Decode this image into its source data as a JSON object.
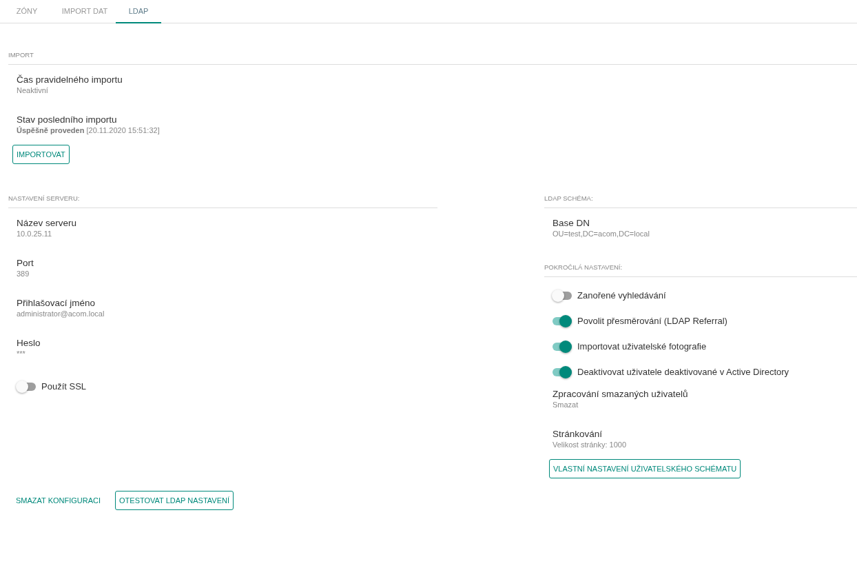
{
  "tabs": [
    {
      "label": "ZÓNY",
      "selected": false
    },
    {
      "label": "IMPORT DAT",
      "selected": false
    },
    {
      "label": "LDAP",
      "selected": true
    }
  ],
  "import": {
    "heading": "IMPORT",
    "items": [
      {
        "kind": "field",
        "label": "Čas pravidelného importu",
        "value": "Neaktivní"
      },
      {
        "kind": "field",
        "label": "Stav posledního importu",
        "value": "**Úspěšně proveden** [20.11.2020 15:51:32]"
      }
    ],
    "button": "IMPORTOVAT"
  },
  "server": {
    "heading": "NASTAVENÍ SERVERU:",
    "items": [
      {
        "kind": "field",
        "label": "Název serveru",
        "value": "10.0.25.11"
      },
      {
        "kind": "field",
        "label": "Port",
        "value": "389"
      },
      {
        "kind": "field",
        "label": "Přihlašovací jméno",
        "value": "administrator@acom.local"
      },
      {
        "kind": "field",
        "label": "Heslo",
        "value": "***"
      },
      {
        "kind": "toggle",
        "label": "Použít SSL",
        "on": false
      }
    ]
  },
  "schema": {
    "heading": "LDAP SCHÉMA:",
    "items": [
      {
        "kind": "field",
        "label": "Base DN",
        "value": "OU=test,DC=acom,DC=local"
      }
    ]
  },
  "advanced": {
    "heading": "POKROČILÁ NASTAVENÍ:",
    "items": [
      {
        "kind": "toggle",
        "label": "Zanořené vyhledávání",
        "on": false
      },
      {
        "kind": "toggle",
        "label": "Povolit přesměrování (LDAP Referral)",
        "on": true
      },
      {
        "kind": "toggle",
        "label": "Importovat uživatelské fotografie",
        "on": true
      },
      {
        "kind": "toggle",
        "label": "Deaktivovat uživatele deaktivované v Active Directory",
        "on": true
      },
      {
        "kind": "field",
        "label": "Zpracování smazaných uživatelů",
        "value": "Smazat"
      },
      {
        "kind": "field",
        "label": "Stránkování",
        "value": "Velikost stránky: 1000"
      }
    ],
    "button": "VLASTNÍ NASTAVENÍ UŽIVATELSKÉHO SCHÉMATU"
  },
  "footer": [
    {
      "kind": "text",
      "label": "SMAZAT KONFIGURACI"
    },
    {
      "kind": "outlined",
      "label": "OTESTOVAT LDAP NASTAVENÍ"
    }
  ]
}
